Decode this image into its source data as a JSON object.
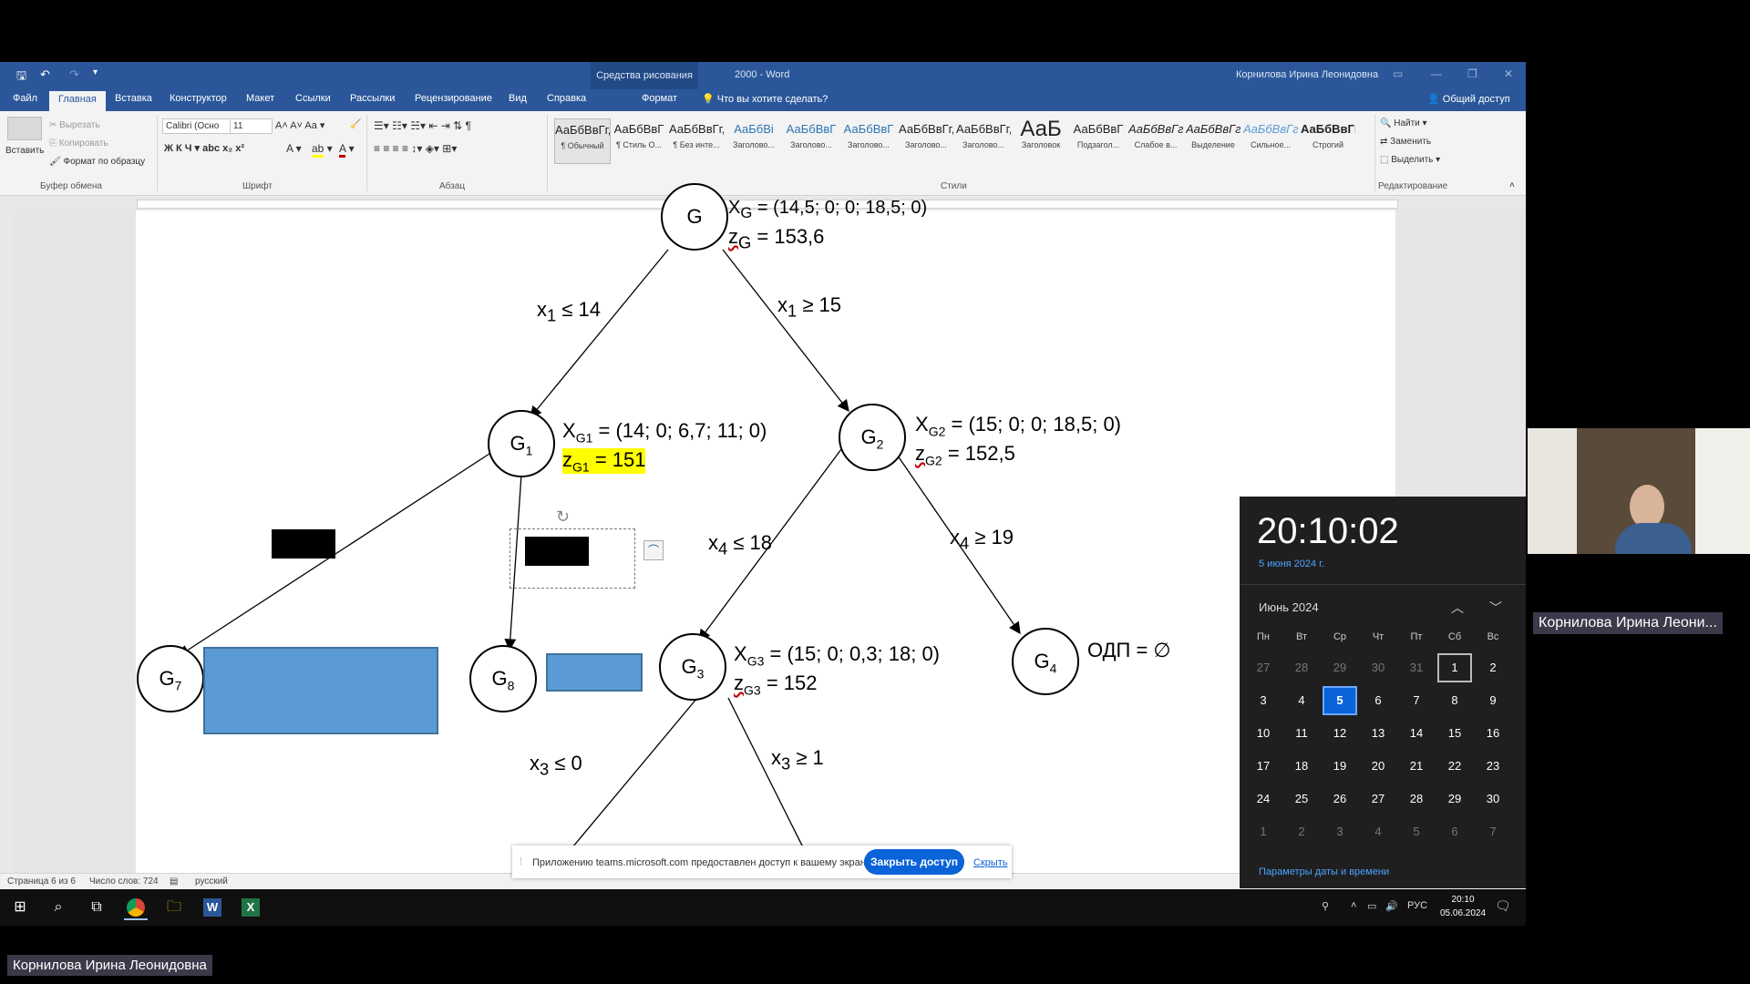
{
  "word": {
    "title": "2000  -  Word",
    "context_tab_group": "Средства рисования",
    "user": "Корнилова Ирина Леонидовна",
    "tabs": [
      "Файл",
      "Главная",
      "Вставка",
      "Конструктор",
      "Макет",
      "Ссылки",
      "Рассылки",
      "Рецензирование",
      "Вид",
      "Справка"
    ],
    "format_tab": "Формат",
    "tell_me": "Что вы хотите сделать?",
    "share": "Общий доступ",
    "clipboard": {
      "paste": "Вставить",
      "cut": "Вырезать",
      "copy": "Копировать",
      "format_painter": "Формат по образцу",
      "group": "Буфер обмена"
    },
    "font": {
      "name": "Calibri (Осно",
      "size": "11",
      "group": "Шрифт"
    },
    "paragraph_group": "Абзац",
    "styles_group": "Стили",
    "styles": [
      {
        "preview": "АаБбВвГг,",
        "name": "¶ Обычный"
      },
      {
        "preview": "АаБбВвГ",
        "name": "¶ Стиль О..."
      },
      {
        "preview": "АаБбВвГг,",
        "name": "¶ Без инте..."
      },
      {
        "preview": "АаБбВі",
        "name": "Заголово..."
      },
      {
        "preview": "АаБбВвГ",
        "name": "Заголово..."
      },
      {
        "preview": "АаБбВвГ",
        "name": "Заголово..."
      },
      {
        "preview": "АаБбВвГг,",
        "name": "Заголово..."
      },
      {
        "preview": "АаБбВвГг,",
        "name": "Заголово..."
      },
      {
        "preview": "АаБ",
        "name": "Заголовок"
      },
      {
        "preview": "АаБбВвГ",
        "name": "Подзагол..."
      },
      {
        "preview": "АаБбВвГг",
        "name": "Слабое в..."
      },
      {
        "preview": "АаБбВвГг",
        "name": "Выделение"
      },
      {
        "preview": "АаБбВвГг",
        "name": "Сильное..."
      },
      {
        "preview": "АаБбВвГг,",
        "name": "Строгий"
      }
    ],
    "editing": {
      "find": "Найти",
      "replace": "Заменить",
      "select": "Выделить",
      "group": "Редактирование"
    },
    "status": {
      "page": "Страница 6 из 6",
      "words": "Число слов: 724",
      "lang": "русский"
    }
  },
  "diagram": {
    "root": {
      "label": "G",
      "x_sub": "G",
      "x_value": "= (14,5; 0; 0; 18,5; 0)",
      "z_sub": "G",
      "z_value": "= 153,6"
    },
    "g1": {
      "label": "G",
      "sub": "1",
      "x_sub": "G1",
      "x_value": "= (14; 0; 6,7; 11; 0)",
      "z_sub": "G1",
      "z_value": "= 151"
    },
    "g2": {
      "label": "G",
      "sub": "2",
      "x_sub": "G2",
      "x_value": "= (15; 0; 0; 18,5; 0)",
      "z_sub": "G2",
      "z_value": "= 152,5"
    },
    "g3": {
      "label": "G",
      "sub": "3",
      "x_sub": "G3",
      "x_value": "= (15; 0; 0,3; 18; 0)",
      "z_sub": "G3",
      "z_value": "= 152"
    },
    "g4": {
      "label": "G",
      "sub": "4",
      "note": "ОДП = ∅"
    },
    "g7": {
      "label": "G",
      "sub": "7"
    },
    "g8": {
      "label": "G",
      "sub": "8"
    },
    "edges": {
      "e1": {
        "var": "x",
        "sub": "1",
        "cond": "≤ 14"
      },
      "e2": {
        "var": "x",
        "sub": "1",
        "cond": "≥ 15"
      },
      "e3": {
        "var": "x",
        "sub": "4",
        "cond": "≤ 18"
      },
      "e4": {
        "var": "x",
        "sub": "4",
        "cond": "≥ 19"
      },
      "e5": {
        "var": "x",
        "sub": "3",
        "cond": "≤ 0"
      },
      "e6": {
        "var": "x",
        "sub": "3",
        "cond": "≥ 1"
      }
    }
  },
  "share_bar": {
    "text": "Приложению teams.microsoft.com предоставлен доступ к вашему экрану.",
    "stop_button": "Закрыть доступ",
    "hide": "Скрыть"
  },
  "clock": {
    "time": "20:10:02",
    "date": "5 июня 2024 г.",
    "month": "Июнь 2024",
    "weekdays": [
      "Пн",
      "Вт",
      "Ср",
      "Чт",
      "Пт",
      "Сб",
      "Вс"
    ],
    "weeks": [
      [
        "27",
        "28",
        "29",
        "30",
        "31",
        "1",
        "2"
      ],
      [
        "3",
        "4",
        "5",
        "6",
        "7",
        "8",
        "9"
      ],
      [
        "10",
        "11",
        "12",
        "13",
        "14",
        "15",
        "16"
      ],
      [
        "17",
        "18",
        "19",
        "20",
        "21",
        "22",
        "23"
      ],
      [
        "24",
        "25",
        "26",
        "27",
        "28",
        "29",
        "30"
      ],
      [
        "1",
        "2",
        "3",
        "4",
        "5",
        "6",
        "7"
      ]
    ],
    "today": "5",
    "hovered": "1",
    "settings_link": "Параметры даты и времени"
  },
  "taskbar": {
    "lang": "РУС",
    "time": "20:10",
    "date": "05.06.2024"
  },
  "participant_name": "Корнилова Ирина Леонидовна",
  "participant_name_short": "Корнилова Ирина Леони...",
  "colors": {
    "word_blue": "#2b579a",
    "highlight": "#ffff00",
    "shape_blue": "#5b9bd5",
    "accent": "#0a63d8"
  }
}
